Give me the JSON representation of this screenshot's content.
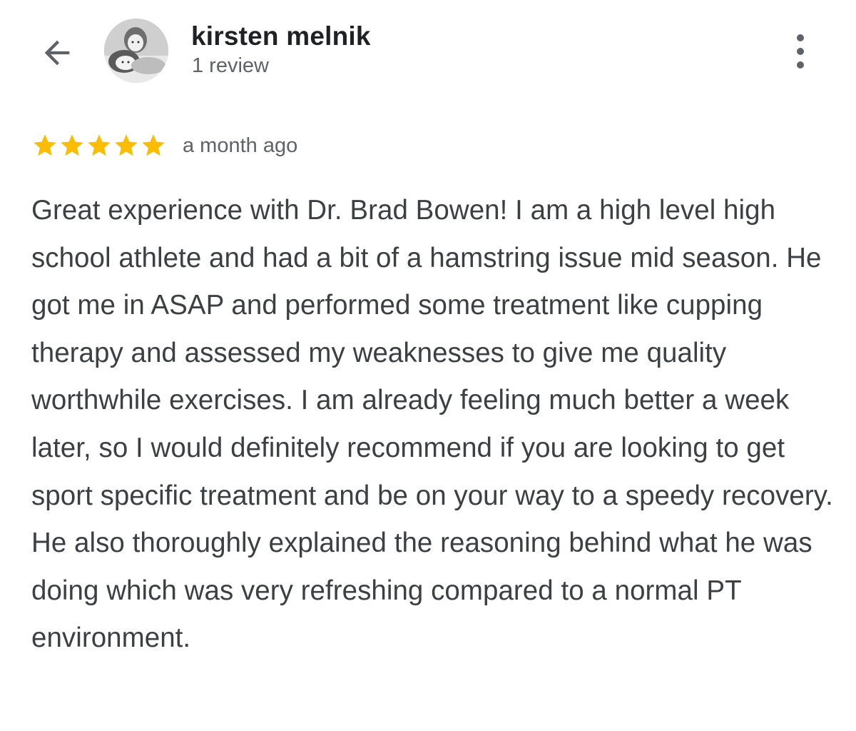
{
  "header": {
    "back_icon": "arrow-back-icon",
    "user_name": "kirsten melnik",
    "review_count": "1 review",
    "more_icon": "more-vertical-icon"
  },
  "review": {
    "rating": 5,
    "rating_max": 5,
    "star_color": "#fbbc04",
    "date": "a month ago",
    "text": "Great experience with Dr. Brad Bowen! I am a high level high school athlete and had a bit of a hamstring issue mid season. He got me in ASAP and performed some treatment like cupping therapy and assessed my weaknesses to give me quality worthwhile exercises. I am already feeling much better a week later, so I would definitely recommend if you are looking to get sport specific treatment and be on your way to a speedy recovery. He also thoroughly explained the reasoning behind what he was doing which was very refreshing compared to a normal PT environment."
  },
  "colors": {
    "icon_gray": "#5f6368",
    "name_color": "#202124",
    "body_text": "#3c4043"
  }
}
